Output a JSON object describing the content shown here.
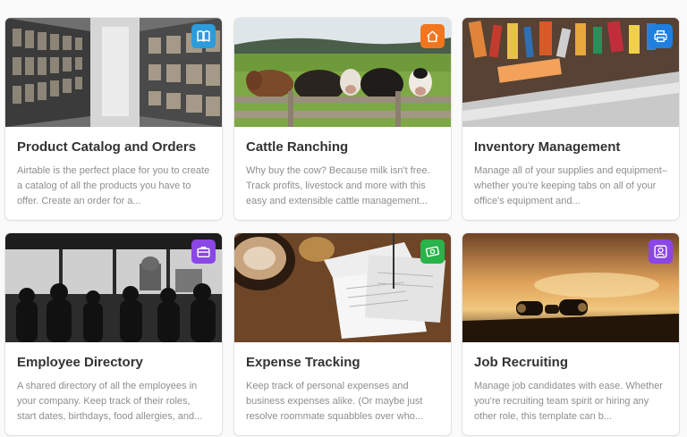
{
  "templates": [
    {
      "title": "Product Catalog and Orders",
      "description": "Airtable is the perfect place for you to create a catalog of all the products you have to offer. Create an order for a...",
      "image": "archive-shelves-photo",
      "icon": "book-icon",
      "icon_color": "#2d9cdb"
    },
    {
      "title": "Cattle Ranching",
      "description": "Why buy the cow? Because milk isn't free. Track profits, livestock and more with this easy and extensible cattle management...",
      "image": "cows-at-fence-photo",
      "icon": "home-icon",
      "icon_color": "#f2761d"
    },
    {
      "title": "Inventory Management",
      "description": "Manage all of your supplies and equipment–whether you're keeping tabs on all of your office's equipment and...",
      "image": "office-supplies-drawer-photo",
      "icon": "printer-icon",
      "icon_color": "#1e7fe0"
    },
    {
      "title": "Employee Directory",
      "description": "A shared directory of all the employees in your company. Keep track of their roles, start dates, birthdays, food allergies, and...",
      "image": "office-silhouettes-photo",
      "icon": "briefcase-icon",
      "icon_color": "#8b46e6"
    },
    {
      "title": "Expense Tracking",
      "description": "Keep track of personal expenses and business expenses alike. (Or maybe just resolve roommate squabbles over who...",
      "image": "receipts-coffee-photo",
      "icon": "money-icon",
      "icon_color": "#29b34a"
    },
    {
      "title": "Job Recruiting",
      "description": "Manage job candidates with ease. Whether you're recruiting team spirit or hiring any other role, this template can b...",
      "image": "binoculars-sunset-photo",
      "icon": "user-icon",
      "icon_color": "#8b46e6"
    }
  ]
}
